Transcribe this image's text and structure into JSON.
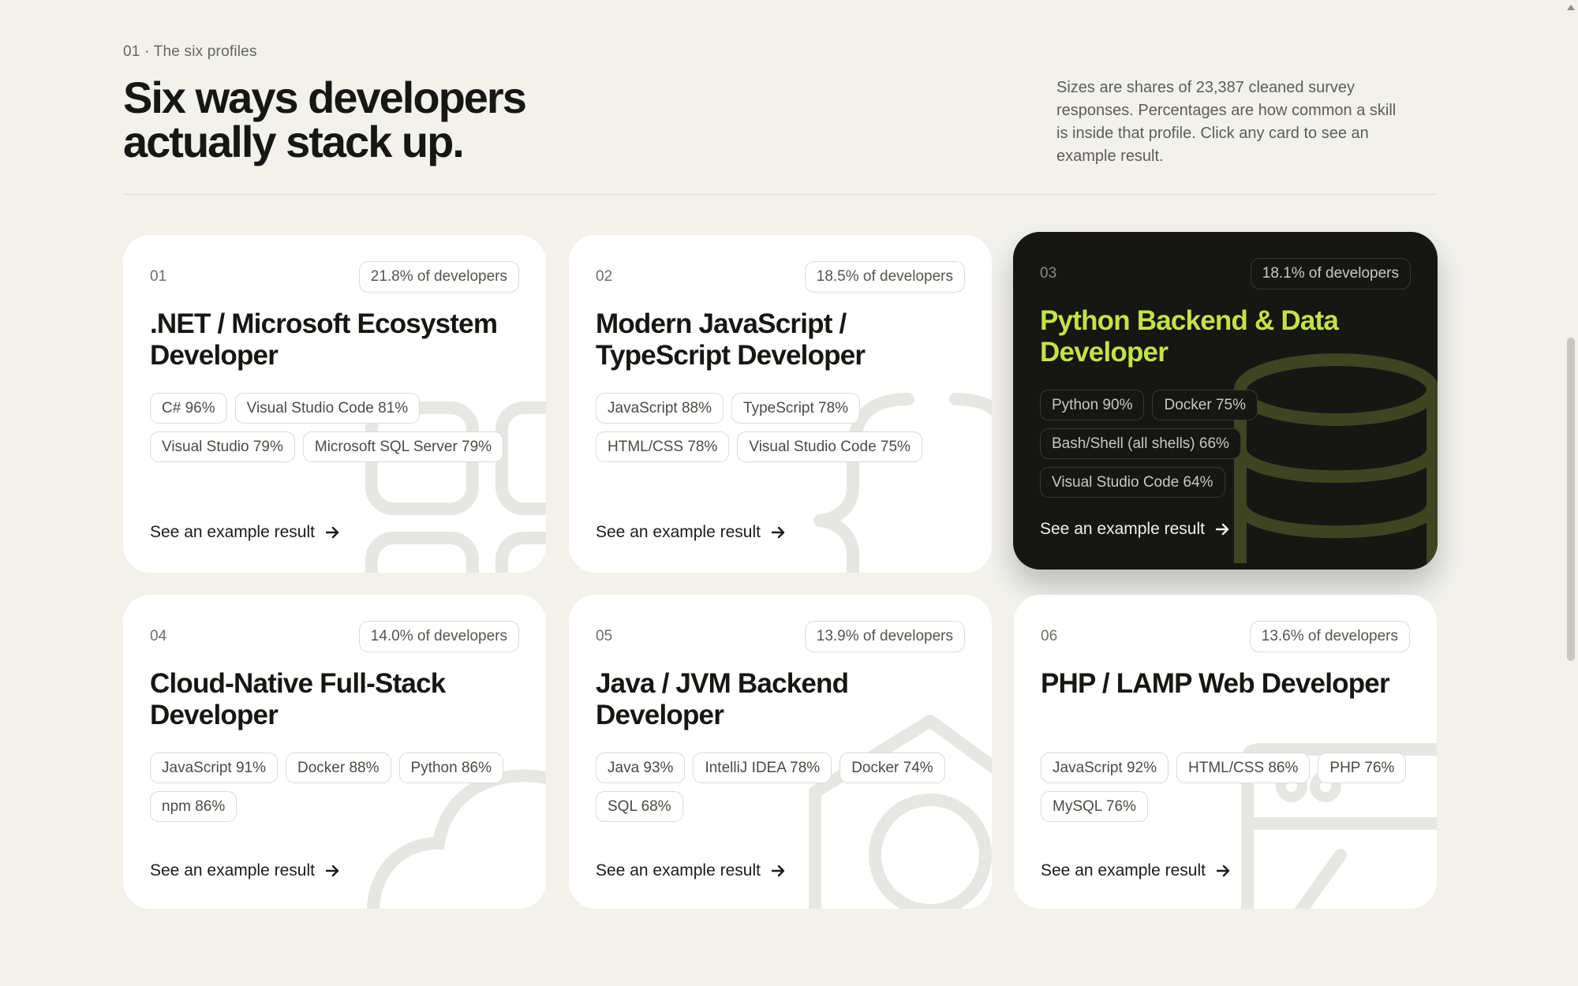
{
  "section": {
    "eyebrow": "01 · The six profiles",
    "headline_line1": "Six ways developers",
    "headline_line2": "actually stack up.",
    "intro": "Sizes are shares of 23,387 cleaned survey responses. Percentages are how common a skill is inside that profile. Click any card to see an example result."
  },
  "colors": {
    "page_background": "#f2f1ec",
    "card_background": "#ffffff",
    "featured_card_background": "#161613",
    "featured_accent": "#c4e04e"
  },
  "cta_icon": "arrow-right-icon",
  "cards": [
    {
      "num": "01",
      "share": "21.8% of developers",
      "title": ".NET / Microsoft Ecosystem Developer",
      "chips": [
        "C# 96%",
        "Visual Studio Code 81%",
        "Visual Studio 79%",
        "Microsoft SQL Server 79%"
      ],
      "cta": "See an example result",
      "icon": "grid-blocks-icon"
    },
    {
      "num": "02",
      "share": "18.5% of developers",
      "title": "Modern JavaScript / TypeScript Developer",
      "chips": [
        "JavaScript 88%",
        "TypeScript 78%",
        "HTML/CSS 78%",
        "Visual Studio Code 75%"
      ],
      "cta": "See an example result",
      "icon": "curly-braces-icon"
    },
    {
      "num": "03",
      "share": "18.1% of developers",
      "title": "Python Backend & Data Developer",
      "chips": [
        "Python 90%",
        "Docker 75%",
        "Bash/Shell (all shells) 66%",
        "Visual Studio Code 64%"
      ],
      "cta": "See an example result",
      "icon": "database-icon",
      "featured": true
    },
    {
      "num": "04",
      "share": "14.0% of developers",
      "title": "Cloud-Native Full-Stack Developer",
      "chips": [
        "JavaScript 91%",
        "Docker 88%",
        "Python 86%",
        "npm 86%"
      ],
      "cta": "See an example result",
      "icon": "cloud-icon"
    },
    {
      "num": "05",
      "share": "13.9% of developers",
      "title": "Java / JVM Backend Developer",
      "chips": [
        "Java 93%",
        "IntelliJ IDEA 78%",
        "Docker 74%",
        "SQL 68%"
      ],
      "cta": "See an example result",
      "icon": "house-circle-icon"
    },
    {
      "num": "06",
      "share": "13.6% of developers",
      "title": "PHP / LAMP Web Developer",
      "chips": [
        "JavaScript 92%",
        "HTML/CSS 86%",
        "PHP 76%",
        "MySQL 76%"
      ],
      "cta": "See an example result",
      "icon": "browser-window-icon"
    }
  ]
}
